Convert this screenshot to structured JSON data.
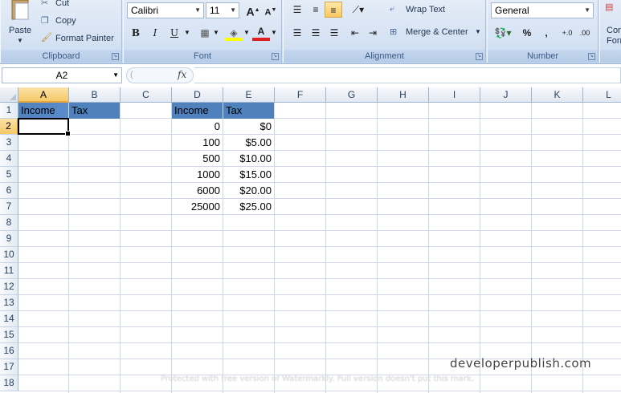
{
  "ribbon": {
    "clipboard": {
      "paste_label": "Paste",
      "cut_label": "Cut",
      "copy_label": "Copy",
      "format_painter_label": "Format Painter",
      "group_label": "Clipboard"
    },
    "font": {
      "font_name": "Calibri",
      "font_size": "11",
      "group_label": "Font"
    },
    "alignment": {
      "wrap_text_label": "Wrap Text",
      "merge_center_label": "Merge & Center",
      "group_label": "Alignment"
    },
    "number": {
      "format": "General",
      "percent_label": "%",
      "comma_label": ",",
      "group_label": "Number"
    },
    "styles": {
      "conditional_formatting_label_1": "Con",
      "conditional_formatting_label_2": "Form"
    }
  },
  "formula_bar": {
    "name_box": "A2",
    "fx_label": "fx",
    "formula": ""
  },
  "sheet": {
    "columns": [
      "A",
      "B",
      "C",
      "D",
      "E",
      "F",
      "G",
      "H",
      "I",
      "J",
      "K",
      "L"
    ],
    "rows": [
      "1",
      "2",
      "3",
      "4",
      "5",
      "6",
      "7",
      "8",
      "9",
      "10",
      "11",
      "12",
      "13",
      "14",
      "15",
      "16",
      "17",
      "18"
    ],
    "selected_column": "A",
    "selected_row": "2",
    "cells": {
      "A1": "Income",
      "B1": "Tax",
      "D1": "Income",
      "E1": "Tax",
      "D2": "0",
      "E2": "$0",
      "D3": "100",
      "E3": "$5.00",
      "D4": "500",
      "E4": "$10.00",
      "D5": "1000",
      "E5": "$15.00",
      "D6": "6000",
      "E6": "$20.00",
      "D7": "25000",
      "E7": "$25.00"
    }
  },
  "watermarks": {
    "brand": "developerpublish.com",
    "protected_notice": "Protected with free version of Watermarkly. Full version doesn't put this mark."
  },
  "colors": {
    "header_fill": "#4f81bd",
    "selection_highlight": "#f5c768",
    "ribbon_bg": "#d7e4f4"
  }
}
